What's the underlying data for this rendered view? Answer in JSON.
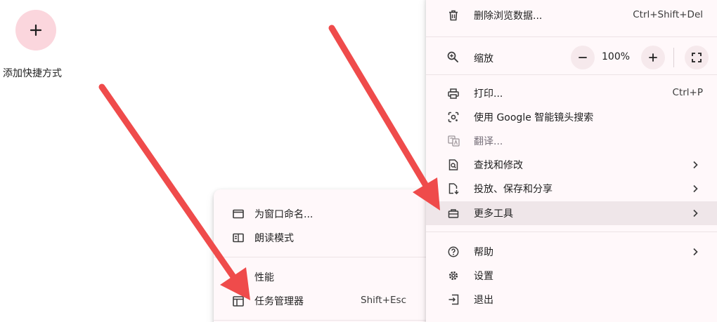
{
  "shortcut": {
    "label": "添加快捷方式",
    "icon": "plus-icon"
  },
  "main_menu": {
    "clear_data": {
      "label": "删除浏览数据...",
      "shortcut": "Ctrl+Shift+Del",
      "icon": "trash-icon"
    },
    "zoom": {
      "label": "缩放",
      "value": "100%",
      "icon": "zoom-icon"
    },
    "print": {
      "label": "打印...",
      "shortcut": "Ctrl+P",
      "icon": "printer-icon"
    },
    "google_lens": {
      "label": "使用 Google 智能镜头搜索",
      "icon": "lens-icon"
    },
    "translate": {
      "label": "翻译...",
      "icon": "translate-icon"
    },
    "find_edit": {
      "label": "查找和修改",
      "icon": "find-icon"
    },
    "cast_save_share": {
      "label": "投放、保存和分享",
      "icon": "cast-save-icon"
    },
    "more_tools": {
      "label": "更多工具",
      "icon": "toolbox-icon"
    },
    "help": {
      "label": "帮助",
      "icon": "help-icon"
    },
    "settings": {
      "label": "设置",
      "icon": "gear-icon"
    },
    "exit": {
      "label": "退出",
      "icon": "exit-icon"
    }
  },
  "sub_menu": {
    "name_window": {
      "label": "为窗口命名...",
      "icon": "window-icon"
    },
    "reading_mode": {
      "label": "朗读模式",
      "icon": "book-icon"
    },
    "performance": {
      "label": "性能",
      "icon": "performance-icon"
    },
    "task_manager": {
      "label": "任务管理器",
      "shortcut": "Shift+Esc",
      "icon": "task-manager-icon"
    }
  },
  "colors": {
    "accent_pink": "#fbd6dd",
    "menu_bg": "#fff8fa",
    "highlight": "#efe6e9",
    "arrow_red": "#ef4b4b"
  }
}
